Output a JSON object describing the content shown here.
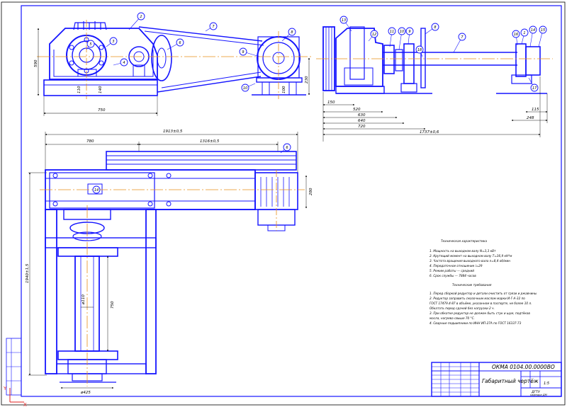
{
  "title_block": {
    "designation": "ОКМА 0104.00.0000ВО",
    "name": "Габаритный чертёж",
    "mass": "",
    "scale": "1:5",
    "sheet": "",
    "org_line1": "ДГТУ",
    "org_line2": "кафедра ДМ"
  },
  "tech_spec": {
    "title": "Техническая характеристика",
    "lines": [
      "1. Мощность на выходном валу N=3,3 кВт",
      "2. Крутящий момент на выходном валу T=36,9 кН*м",
      "3. Частота вращения выходного вала n=8,4 об/мин",
      "4. Передаточное отношение i=29",
      "5. Режим работы — средний",
      "6. Срок службы — 7884 часов"
    ]
  },
  "tech_req": {
    "title": "Технические требования",
    "lines": [
      "1. Перед сборкой редуктор и детали очистить от грязи и ржавчины",
      "2. Редуктор заправить смазочным маслом марки И-Г-А-32 по",
      "ГОСТ 17479.4-87 в объёме, указанном в паспорте, не более 10 л.",
      "Обкатать перед сдачей без нагрузки 2 ч.",
      "3. При обкатке редуктор не должен быть стук и шум, подтёков",
      "масла, нагрева свыше 70 °С.",
      "4. Сварные подшипники по ИНН ИП-27А по ГОСТ 16337-73"
    ]
  },
  "dims": {
    "left_w": "750",
    "left_h": "590",
    "left_foot_a": "110",
    "left_foot_b": "140",
    "motor_h": "230",
    "motor_base": "100",
    "right_a": "150",
    "right_b": "520",
    "right_c": "630",
    "right_d": "640",
    "right_e": "720",
    "right_total": "1737±0,6",
    "right_f": "115",
    "right_g": "248",
    "plan_total": "1913±0,5",
    "plan_a": "780",
    "plan_b": "1316±0,5",
    "plan_h": "1940±1,5",
    "plan_motor": "280",
    "plan_shaft": "ø110",
    "plan_shaft_len": "750",
    "plan_bottom": "ø425"
  },
  "balloons": {
    "left": [
      "2",
      "3",
      "4",
      "5",
      "6",
      "7",
      "8",
      "9",
      "10"
    ],
    "right": [
      "13",
      "12",
      "11",
      "10",
      "9",
      "8",
      "7",
      "1",
      "14",
      "15",
      "16",
      "17",
      "18"
    ],
    "plan": [
      "6",
      "14"
    ]
  },
  "stamp": {
    "side_top": "",
    "side_bottom": ""
  },
  "axis": {
    "x": "X",
    "y": "Y"
  }
}
